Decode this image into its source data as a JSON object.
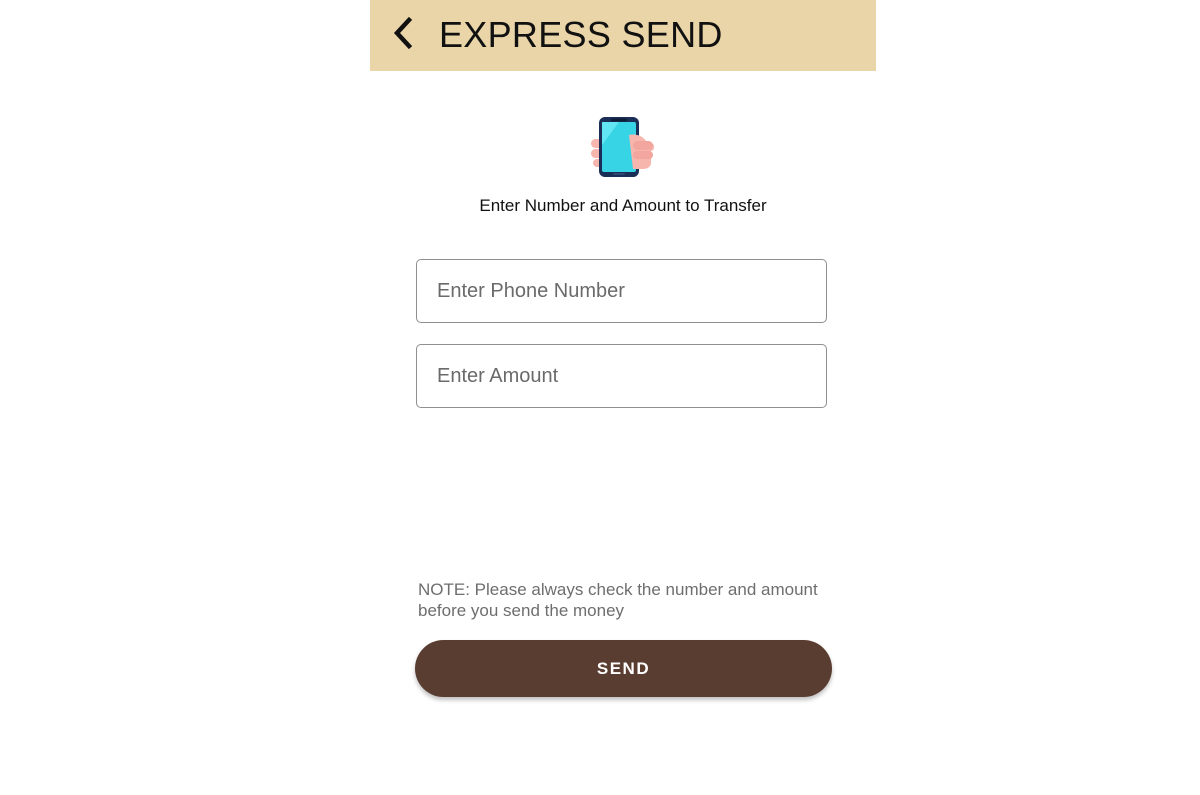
{
  "header": {
    "back_icon": "chevron-left-icon",
    "title": "EXPRESS SEND",
    "background": "#e9d5a7"
  },
  "hero": {
    "icon": "hand-holding-phone-icon",
    "subtitle": "Enter Number and Amount to Transfer"
  },
  "form": {
    "phone_placeholder": "Enter Phone Number",
    "phone_value": "",
    "amount_placeholder": "Enter Amount",
    "amount_value": ""
  },
  "note": "NOTE: Please always check the number and amount before you send the money",
  "send": {
    "label": "SEND",
    "color": "#5a3d31"
  }
}
